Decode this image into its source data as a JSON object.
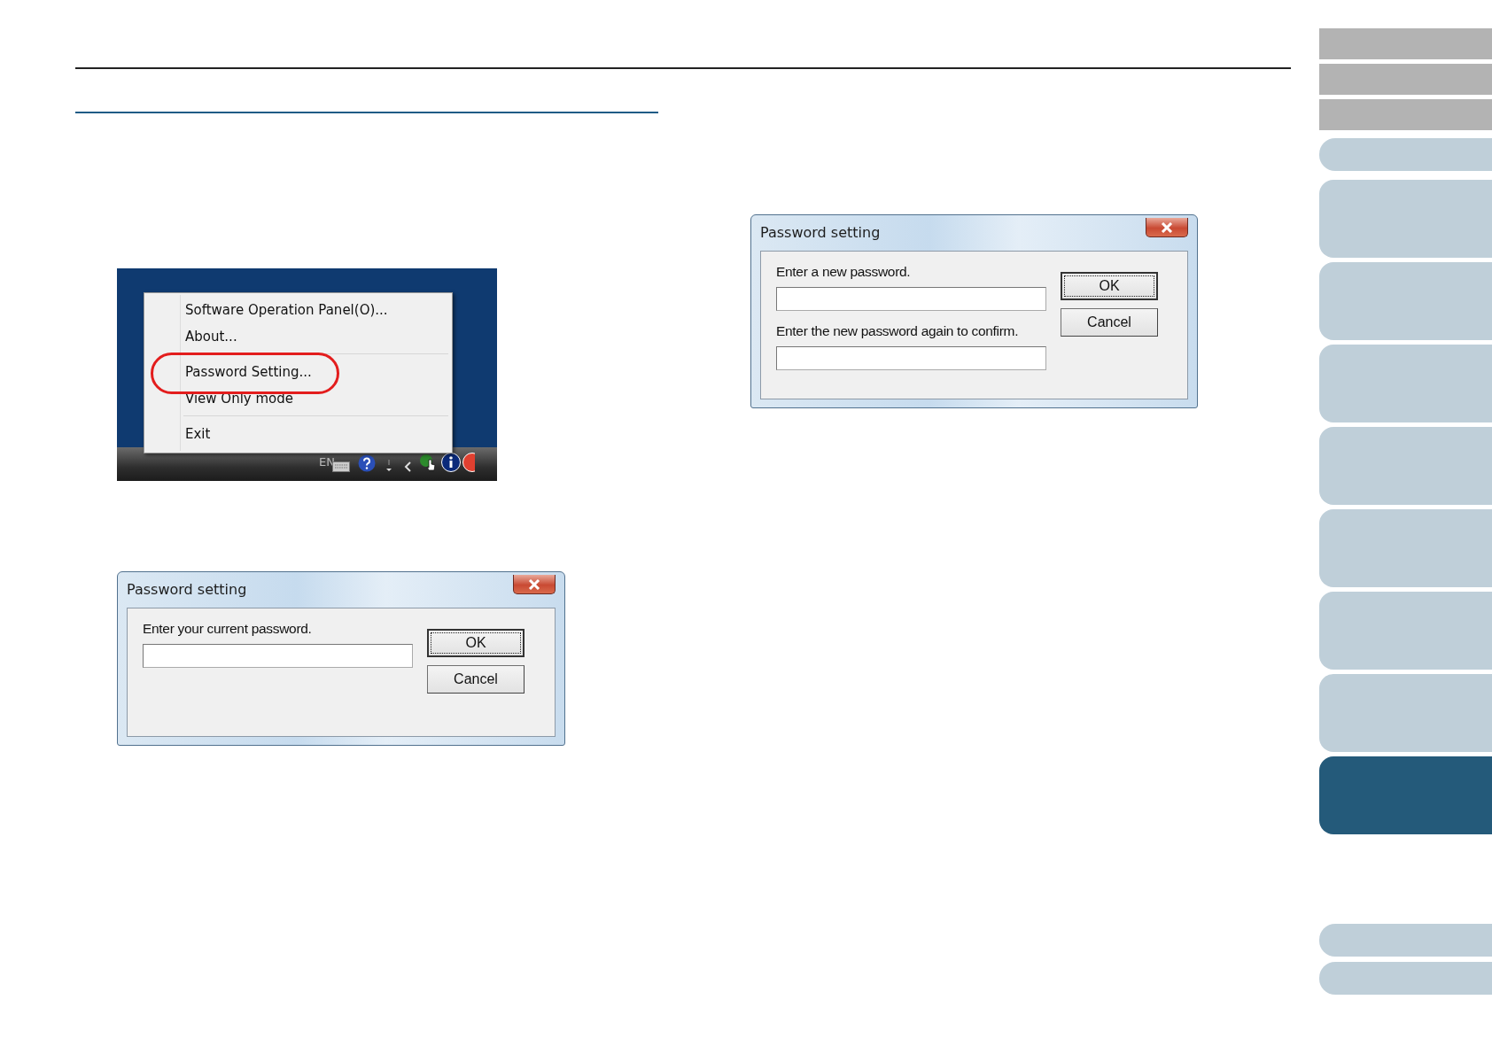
{
  "tray_screenshot": {
    "menu": {
      "items": [
        {
          "kind": "item",
          "label": "Software Operation Panel(O)...",
          "circled": false
        },
        {
          "kind": "item",
          "label": "About...",
          "circled": false
        },
        {
          "kind": "separator"
        },
        {
          "kind": "item",
          "label": "Password Setting...",
          "circled": true
        },
        {
          "kind": "item",
          "label": "View Only mode",
          "circled": false
        },
        {
          "kind": "separator"
        },
        {
          "kind": "item",
          "label": "Exit",
          "circled": false
        }
      ]
    },
    "taskbar": {
      "language": "EN"
    }
  },
  "dialogs": [
    {
      "title": "Password setting",
      "fields": [
        {
          "label": "Enter your current password."
        }
      ],
      "buttons": [
        {
          "label": "OK",
          "default": true
        },
        {
          "label": "Cancel",
          "default": false
        }
      ]
    },
    {
      "title": "Password setting",
      "fields": [
        {
          "label": "Enter a new password."
        },
        {
          "label": "Enter the new password again to confirm."
        }
      ],
      "buttons": [
        {
          "label": "OK",
          "default": true
        },
        {
          "label": "Cancel",
          "default": false
        }
      ]
    }
  ],
  "nav_tabs": [
    {
      "kind": "grey",
      "selected": false
    },
    {
      "kind": "grey",
      "selected": false
    },
    {
      "kind": "grey",
      "selected": false
    },
    {
      "kind": "pill",
      "selected": false
    },
    {
      "kind": "chapter",
      "selected": false
    },
    {
      "kind": "chapter",
      "selected": false
    },
    {
      "kind": "chapter",
      "selected": false
    },
    {
      "kind": "chapter",
      "selected": false
    },
    {
      "kind": "chapter",
      "selected": false
    },
    {
      "kind": "chapter",
      "selected": false
    },
    {
      "kind": "chapter",
      "selected": false
    },
    {
      "kind": "chapter",
      "selected": true
    }
  ],
  "footer_tabs": [
    {
      "kind": "pill",
      "selected": false
    },
    {
      "kind": "pill",
      "selected": false
    }
  ]
}
